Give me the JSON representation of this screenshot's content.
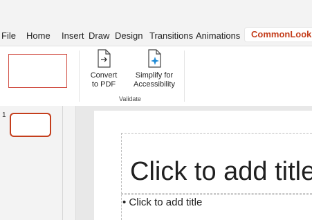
{
  "menu": {
    "tabs": [
      {
        "label": "File"
      },
      {
        "label": "Home"
      },
      {
        "label": "Insert"
      },
      {
        "label": "Draw"
      },
      {
        "label": "Design"
      },
      {
        "label": "Transitions"
      },
      {
        "label": "Animations"
      },
      {
        "label": "CommonLook",
        "active": true
      }
    ]
  },
  "ribbon": {
    "convert_label_line1": "Convert",
    "convert_label_line2": "to PDF",
    "simplify_label_line1": "Simplify for",
    "simplify_label_line2": "Accessibility",
    "group_label": "Validate"
  },
  "thumbnails": [
    {
      "number": "1"
    }
  ],
  "slide": {
    "title_placeholder": "Click to add title",
    "body_placeholder": "• Click to add title"
  },
  "colors": {
    "accent": "#c43e1c",
    "highlight_box": "#d14f45",
    "icon_blue": "#1f8ad6"
  }
}
